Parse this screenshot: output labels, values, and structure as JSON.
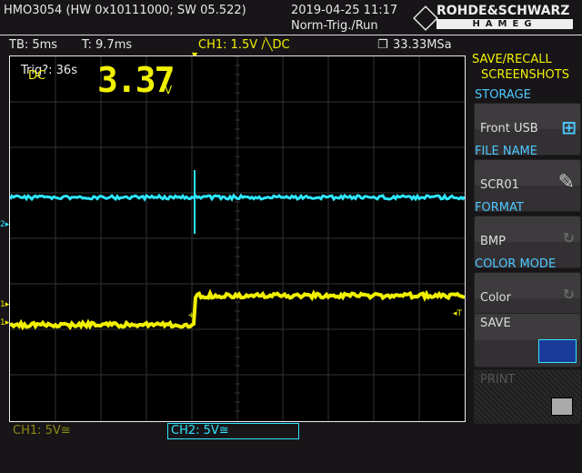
{
  "header": {
    "device": "HMO3054 (HW 0x10111000; SW 05.522)",
    "datetime": "2019-04-25 11:17",
    "trigger_mode": "Norm-Trig./Run",
    "logo_top": "ROHDE&SCHWARZ",
    "logo_bottom": "HAMEG"
  },
  "status": {
    "timebase": "TB: 5ms",
    "trigger_time": "T: 9.7ms",
    "ch1_trigger": "CH1: 1.5V ∕╲DC",
    "sample_rate": "33.33MSa"
  },
  "display": {
    "trig_wait": "Trig?: 36s",
    "meas_label": "DC",
    "meas_value": "3.37",
    "meas_unit": "V"
  },
  "menu": {
    "title1": "SAVE/RECALL",
    "title2": "SCREENSHOTS",
    "storage_label": "STORAGE",
    "storage_value": "Front USB",
    "filename_label": "FILE NAME",
    "filename_value": "SCR01",
    "format_label": "FORMAT",
    "format_value": "BMP",
    "colormode_label": "COLOR MODE",
    "colormode_value": "Color",
    "save": "SAVE",
    "print": "PRINT"
  },
  "footer": {
    "ch1": "CH1: 5V≅",
    "ch2": "CH2: 5V≅"
  },
  "colors": {
    "ch1": "#f0f000",
    "ch2": "#2ee6ff"
  }
}
